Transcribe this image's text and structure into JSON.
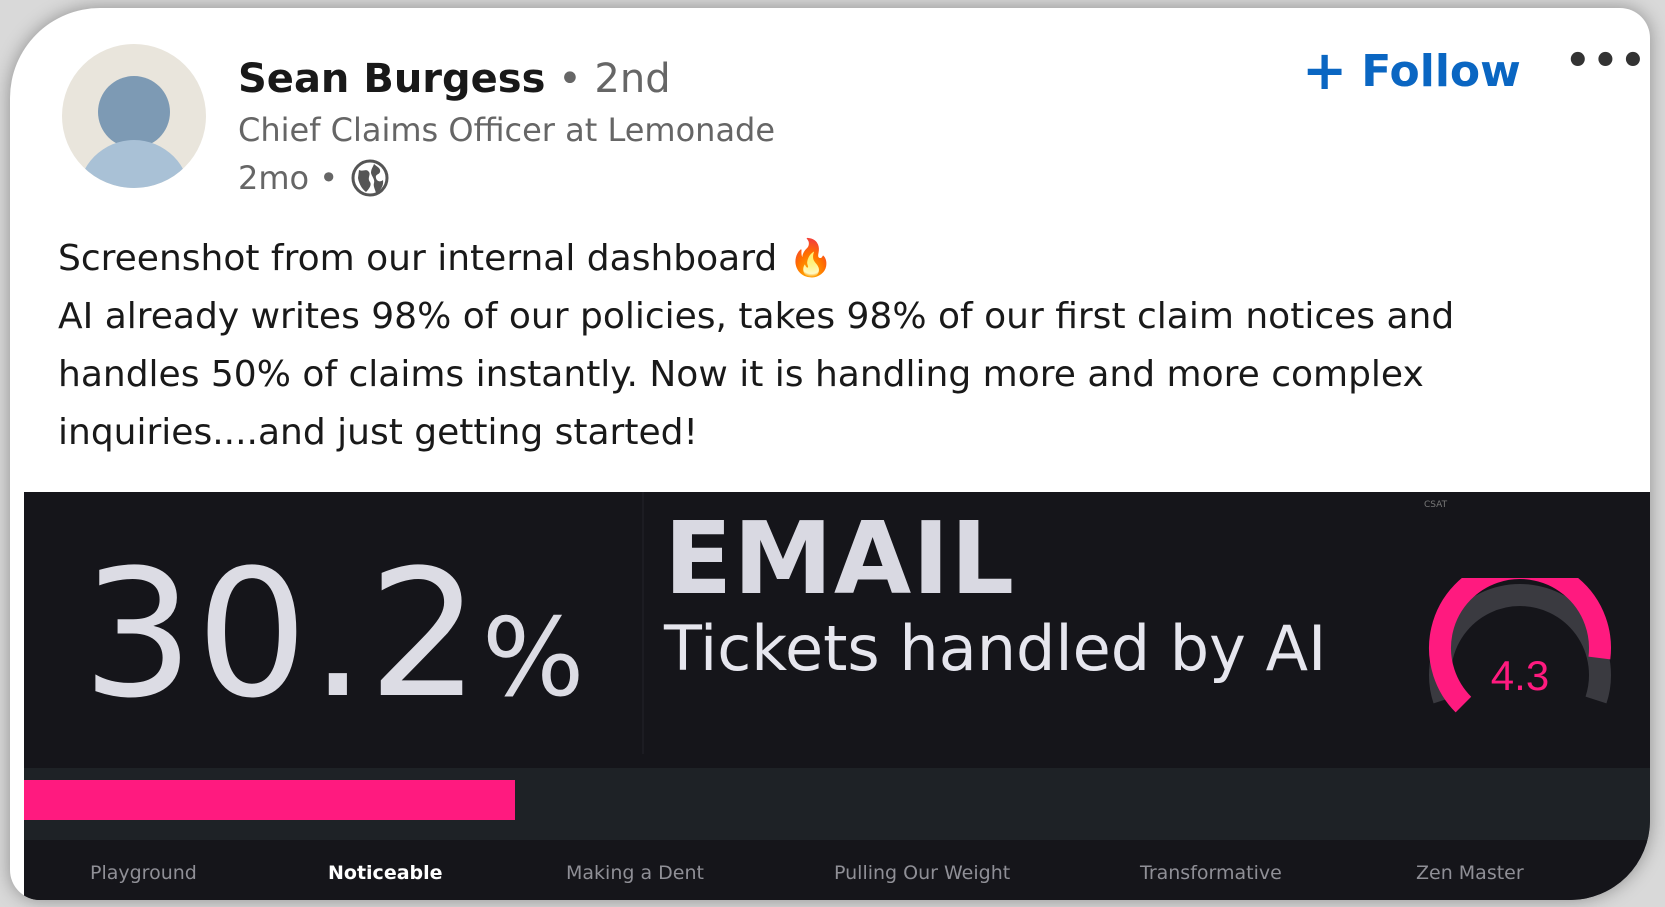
{
  "author": {
    "name": "Sean Burgess",
    "degree": "• 2nd",
    "headline": "Chief Claims Officer at Lemonade",
    "time": "2mo •"
  },
  "actions": {
    "follow_label": "Follow",
    "follow_icon": "plus-icon",
    "more_label": "•••"
  },
  "post": {
    "lines": [
      "Screenshot from our internal dashboard 🔥",
      "AI already writes 98% of our policies, takes 98% of our first claim notices and",
      "handles 50% of claims instantly. Now it is handling more and more complex",
      "inquiries....and just getting started!"
    ]
  },
  "dashboard": {
    "percent_value": "30.2",
    "percent_symbol": "%",
    "channel": "EMAIL",
    "subtitle": "Tickets handled by AI",
    "csat_label": "CSAT",
    "gauge_value": "4.3",
    "gauge_fraction": 0.86,
    "progress_fraction": 0.302,
    "tiers": [
      "Playground",
      "Noticeable",
      "Making a Dent",
      "Pulling Our Weight",
      "Transformative",
      "Zen Master"
    ],
    "active_tier": "Noticeable"
  },
  "colors": {
    "accent_pink": "#ff1a7f",
    "follow_blue": "#0a66c2",
    "dash_bg": "#15151a"
  }
}
